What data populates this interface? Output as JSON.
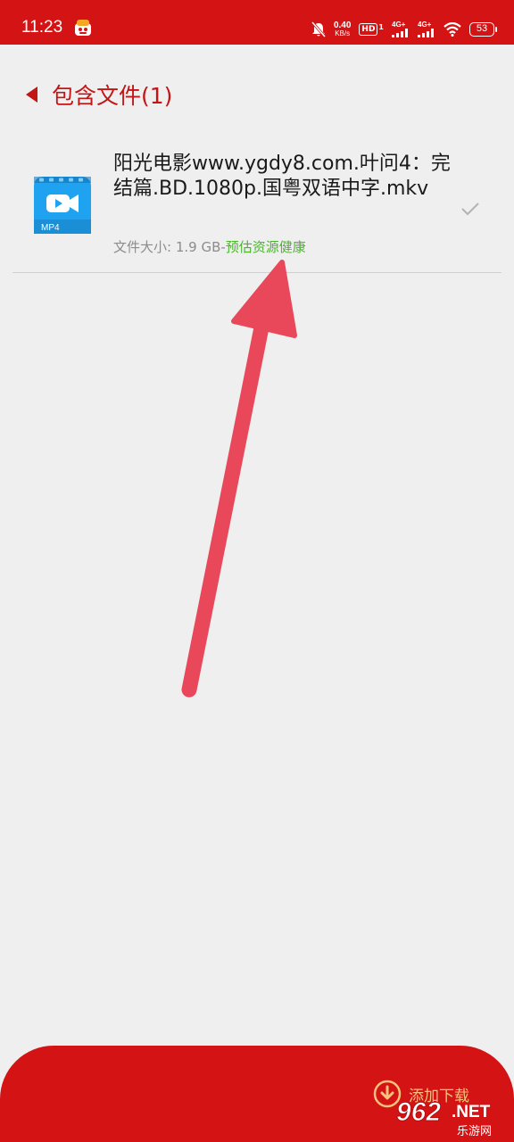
{
  "status_bar": {
    "time": "11:23",
    "net_speed_value": "0.40",
    "net_speed_unit": "KB/s",
    "hd_badge": "HD",
    "hd_sub": "1",
    "signal1": "4G+",
    "signal2": "4G+",
    "battery": "53"
  },
  "header": {
    "title": "包含文件(1)"
  },
  "file": {
    "name": "阳光电影www.ygdy8.com.叶问4：完结篇.BD.1080p.国粤双语中字.mkv",
    "icon_label": "MP4",
    "size_prefix": "文件大小: 1.9 GB-",
    "health": "预估资源健康"
  },
  "bottom": {
    "download_label": "添加下载"
  },
  "watermark": {
    "brand": "962",
    "suffix": ".NET",
    "sub": "乐游网"
  },
  "colors": {
    "accent": "#d41315",
    "title_red": "#c31516",
    "health_green": "#49b62a",
    "icon_blue": "#1fa3f0",
    "arrow": "#e8485a"
  }
}
